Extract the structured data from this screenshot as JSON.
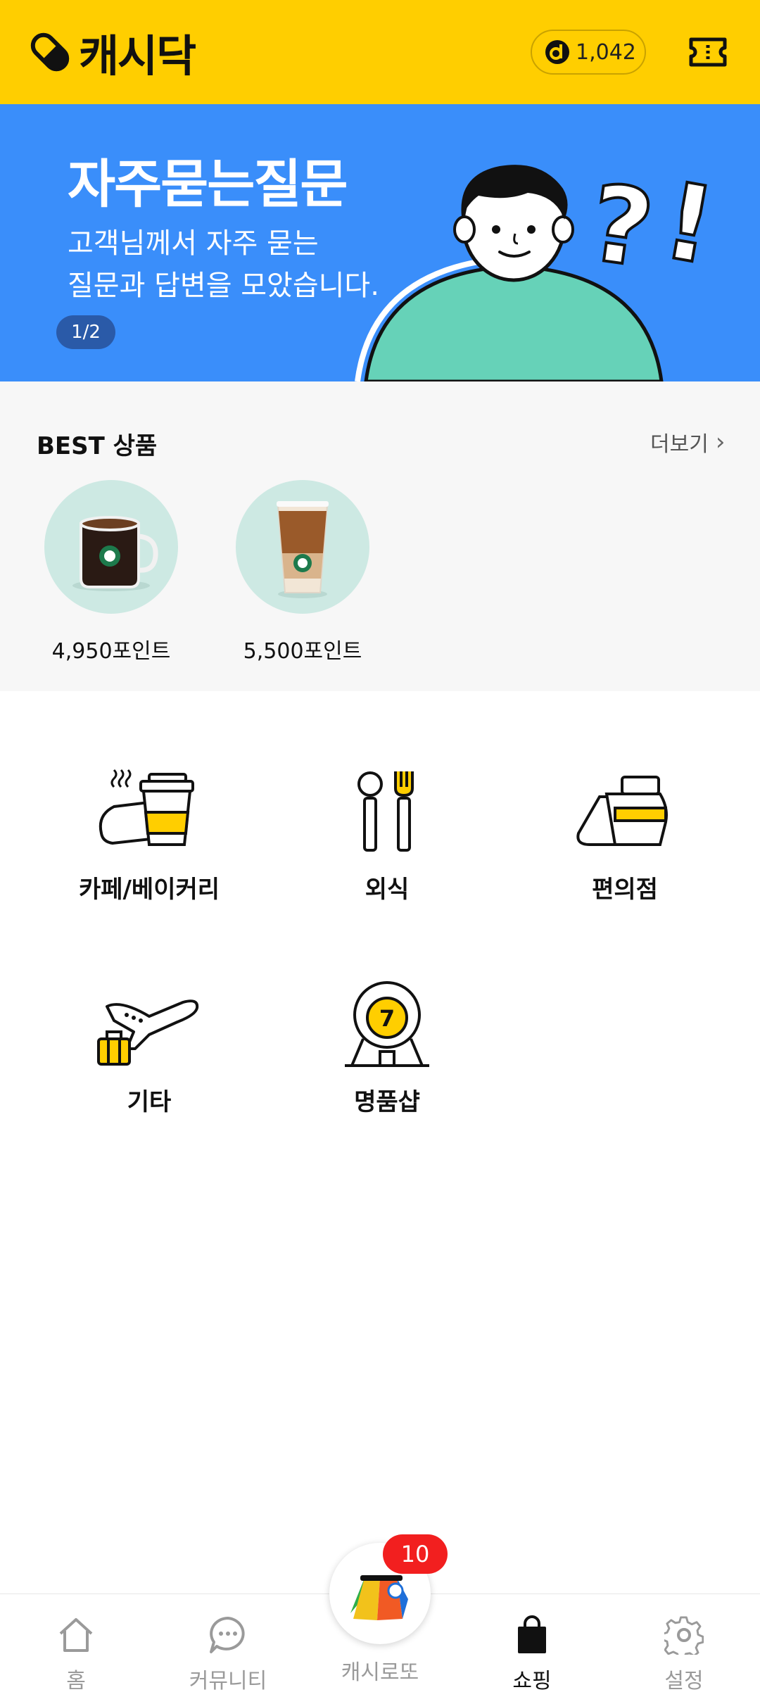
{
  "header": {
    "app_name": "캐시닥",
    "points": "1,042"
  },
  "banner": {
    "title": "자주묻는질문",
    "subtitle_line1": "고객님께서 자주 묻는",
    "subtitle_line2": "질문과 답변을 모았습니다.",
    "page": "1/2"
  },
  "best": {
    "title": "BEST 상품",
    "more": "더보기",
    "products": [
      {
        "price": "4,950포인트",
        "image": "hot-coffee-mug"
      },
      {
        "price": "5,500포인트",
        "image": "iced-latte-cup"
      }
    ]
  },
  "categories": [
    {
      "label": "카페/베이커리",
      "icon": "cafe-bakery-icon"
    },
    {
      "label": "외식",
      "icon": "dining-icon"
    },
    {
      "label": "편의점",
      "icon": "convenience-store-icon"
    },
    {
      "label": "기타",
      "icon": "travel-icon"
    },
    {
      "label": "명품샵",
      "icon": "luxury-shop-icon"
    }
  ],
  "nav": {
    "items": [
      {
        "label": "홈",
        "icon": "home-icon"
      },
      {
        "label": "커뮤니티",
        "icon": "chat-icon"
      },
      {
        "label": "캐시로또",
        "icon": "lotto-icon"
      },
      {
        "label": "쇼핑",
        "icon": "shopping-bag-icon"
      },
      {
        "label": "설정",
        "icon": "settings-gear-icon"
      }
    ],
    "lotto_badge": "10",
    "active": "쇼핑"
  },
  "colors": {
    "header_bg": "#FFCE00",
    "banner_bg": "#3A8EFA",
    "best_bg": "#F7F7F7",
    "badge_red": "#F21F1F",
    "product_circle": "#CDE9E3"
  }
}
